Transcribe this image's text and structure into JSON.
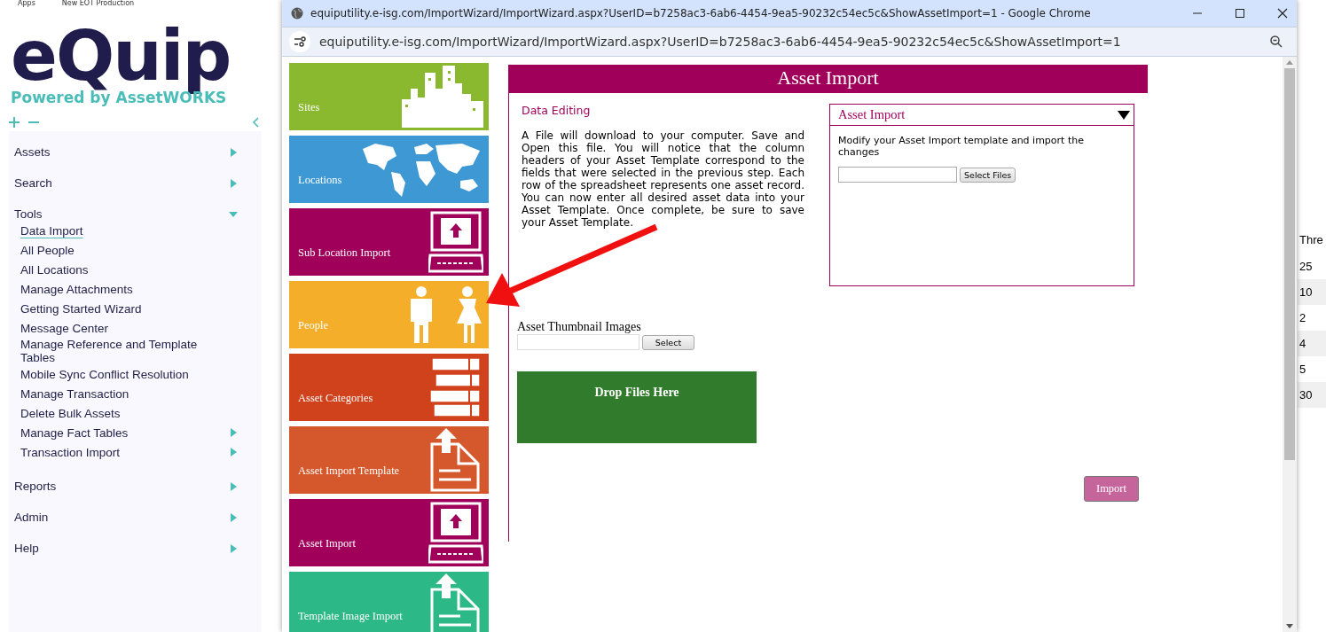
{
  "bookmarks": [
    "Apps",
    "New EOT Production"
  ],
  "logo": {
    "wordmark": "eQuip",
    "tagline": "Powered by AssetWORKS"
  },
  "sidebar": {
    "items": [
      {
        "label": "Assets",
        "expanded": false
      },
      {
        "label": "Search",
        "expanded": false
      },
      {
        "label": "Tools",
        "expanded": true,
        "children": [
          {
            "label": "Data Import",
            "selected": true
          },
          {
            "label": "All People",
            "selected": false
          },
          {
            "label": "All Locations",
            "selected": false
          },
          {
            "label": "Manage Attachments",
            "selected": false
          },
          {
            "label": "Getting Started Wizard",
            "selected": false
          },
          {
            "label": "Message Center",
            "selected": false
          },
          {
            "label": "Manage Reference and Template Tables",
            "selected": false
          },
          {
            "label": "Mobile Sync Conflict Resolution",
            "selected": false
          },
          {
            "label": "Manage Transaction",
            "selected": false
          },
          {
            "label": "Delete Bulk Assets",
            "selected": false
          },
          {
            "label": "Manage Fact Tables",
            "selected": false,
            "expanded": false
          },
          {
            "label": "Transaction Import",
            "selected": false,
            "expanded": false
          }
        ]
      },
      {
        "label": "Reports",
        "expanded": false
      },
      {
        "label": "Admin",
        "expanded": false
      },
      {
        "label": "Help",
        "expanded": false
      }
    ]
  },
  "background_table": {
    "column_1": "Thre",
    "rows": [
      "25",
      "10",
      "2",
      "4",
      "5",
      "30"
    ]
  },
  "popup": {
    "title": "equiputility.e-isg.com/ImportWizard/ImportWizard.aspx?UserID=b7258ac3-6ab6-4454-9ea5-90232c54ec5c&ShowAssetImport=1 - Google Chrome",
    "url": "equiputility.e-isg.com/ImportWizard/ImportWizard.aspx?UserID=b7258ac3-6ab6-4454-9ea5-90232c54ec5c&ShowAssetImport=1",
    "tiles": [
      {
        "label": "Sites",
        "kind": "city",
        "color": "#8ab82e"
      },
      {
        "label": "Locations",
        "kind": "map",
        "color": "#3d98d3"
      },
      {
        "label": "Sub Location Import",
        "kind": "computer",
        "color": "#a0005a"
      },
      {
        "label": "People",
        "kind": "people",
        "color": "#f4ae2a"
      },
      {
        "label": "Asset Categories",
        "kind": "books",
        "color": "#d0421c"
      },
      {
        "label": "Asset Import Template",
        "kind": "document",
        "color": "#d4582b"
      },
      {
        "label": "Asset Import",
        "kind": "computer",
        "color": "#a0005a"
      },
      {
        "label": "Template Image Import",
        "kind": "document",
        "color": "#2db887"
      }
    ],
    "heading": "Asset Import",
    "section_title": "Data Editing",
    "description": "A File will download to your computer. Save and Open this file. You will notice that the column headers of your Asset Template correspond to the fields that were selected in the previous step. Each row of the spreadsheet represents one asset record. You can now enter all desired asset data into your Asset Template. Once complete, be sure to save your Asset Template.",
    "accordion": {
      "title": "Asset Import",
      "expanded": true,
      "hint": "Modify your Asset Import template and import the changes",
      "button": "Select Files"
    },
    "thumbnails": {
      "label": "Asset Thumbnail Images",
      "button": "Select"
    },
    "dropzone": "Drop Files Here",
    "import_button": {
      "label": "Import",
      "disabled": true
    }
  }
}
